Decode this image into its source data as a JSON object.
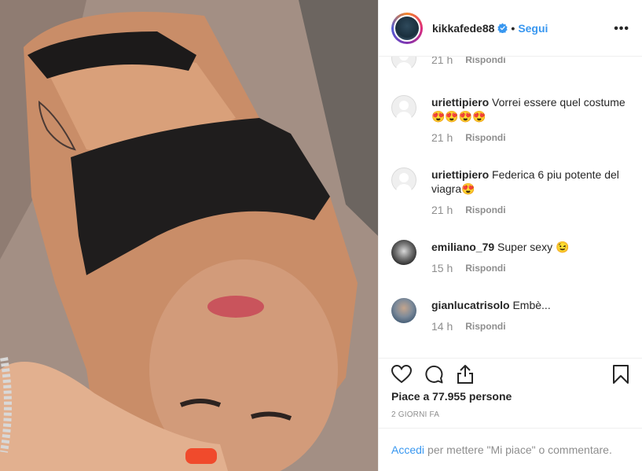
{
  "post": {
    "username": "kikkafede88",
    "separator": "•",
    "follow_label": "Segui",
    "more_label": "•••"
  },
  "comments": [
    {
      "user": "",
      "text": "",
      "time": "21 h",
      "reply": "Rispondi"
    },
    {
      "user": "uriettipiero",
      "text": " Vorrei essere quel costume",
      "emoji": "😍😍😍😍",
      "time": "21 h",
      "reply": "Rispondi"
    },
    {
      "user": "uriettipiero",
      "text": " Federica 6 piu potente del viagra",
      "emoji": "😍",
      "time": "21 h",
      "reply": "Rispondi"
    },
    {
      "user": "emiliano_79",
      "text": " Super sexy ",
      "emoji": "😉",
      "time": "15 h",
      "reply": "Rispondi"
    },
    {
      "user": "gianlucatrisolo",
      "text": " Embè...",
      "time": "14 h",
      "reply": "Rispondi"
    }
  ],
  "actions": {
    "likes": "Piace a 77.955 persone",
    "date": "2 GIORNI FA"
  },
  "login": {
    "link": "Accedi",
    "text": "per mettere \"Mi piace\" o commentare."
  },
  "icons": [
    "heart-icon",
    "comment-icon",
    "share-icon",
    "bookmark-icon",
    "verified-badge-icon",
    "more-options-icon"
  ],
  "colors": {
    "accent": "#3897f0",
    "muted": "#8e8e8e",
    "text": "#262626"
  }
}
